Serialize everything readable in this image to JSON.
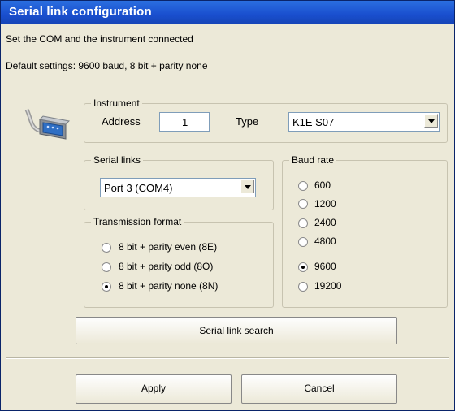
{
  "window": {
    "title": "Serial link configuration"
  },
  "intro": {
    "line1": "Set the COM and the instrument connected",
    "line2": "Default settings: 9600 baud, 8 bit + parity none"
  },
  "icon": {
    "name": "serial-connector-icon"
  },
  "instrument": {
    "legend": "Instrument",
    "address_label": "Address",
    "address_value": "1",
    "type_label": "Type",
    "type_value": "K1E S07"
  },
  "serial_links": {
    "legend": "Serial links",
    "selected": "Port 3 (COM4)"
  },
  "baud_rate": {
    "legend": "Baud rate",
    "options": [
      "600",
      "1200",
      "2400",
      "4800",
      "9600",
      "19200"
    ],
    "selected": "9600"
  },
  "transmission": {
    "legend": "Transmission format",
    "options": [
      "8 bit + parity even (8E)",
      "8 bit + parity odd (8O)",
      "8 bit + parity none (8N)"
    ],
    "selected": "8 bit + parity none (8N)"
  },
  "buttons": {
    "search": "Serial link search",
    "apply": "Apply",
    "cancel": "Cancel"
  }
}
